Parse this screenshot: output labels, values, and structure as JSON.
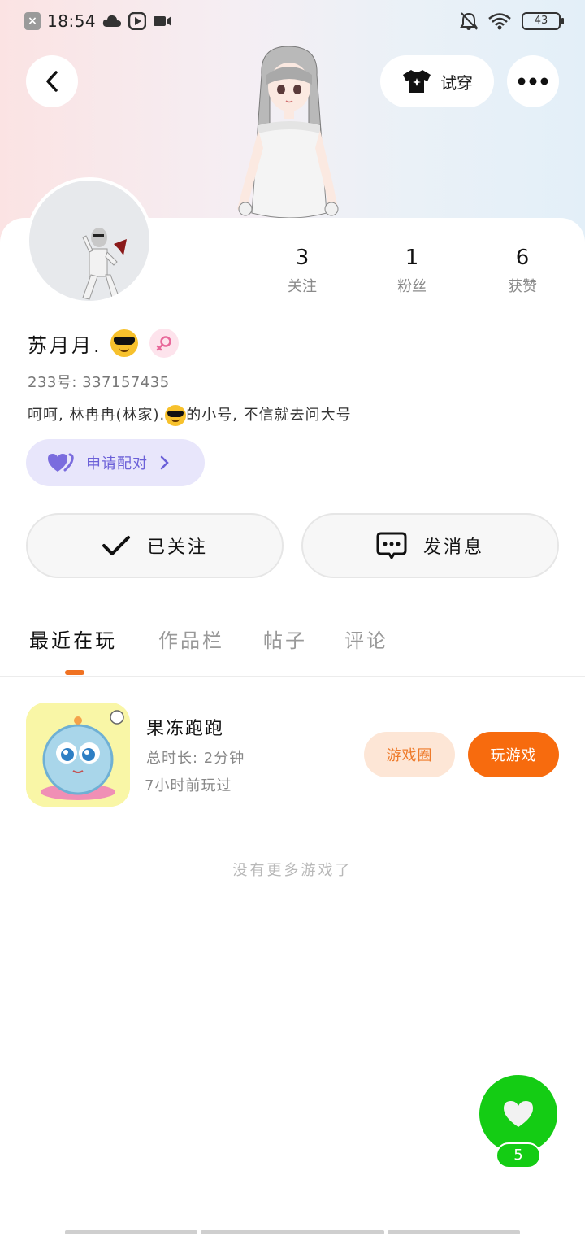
{
  "status_bar": {
    "time": "18:54",
    "battery": "43"
  },
  "header": {
    "try_on_label": "试穿"
  },
  "stats": [
    {
      "value": "3",
      "label": "关注"
    },
    {
      "value": "1",
      "label": "粉丝"
    },
    {
      "value": "6",
      "label": "获赞"
    }
  ],
  "profile": {
    "username": "苏月月.",
    "uid": "233号: 337157435",
    "bio_part1": "呵呵, 林冉冉(林家).",
    "bio_part2": "的小号, 不信就去问大号",
    "pair_label": "申请配对"
  },
  "actions": {
    "follow_label": "已关注",
    "message_label": "发消息"
  },
  "tabs": [
    "最近在玩",
    "作品栏",
    "帖子",
    "评论"
  ],
  "game": {
    "title": "果冻跑跑",
    "duration": "总时长: 2分钟",
    "last_played": "7小时前玩过",
    "circle_label": "游戏圈",
    "play_label": "玩游戏"
  },
  "empty_hint": "没有更多游戏了",
  "likes": {
    "count": "5"
  },
  "colors": {
    "accent": "#f76b0e",
    "like_green": "#14cc14",
    "pair_purple": "#6b60d8"
  }
}
